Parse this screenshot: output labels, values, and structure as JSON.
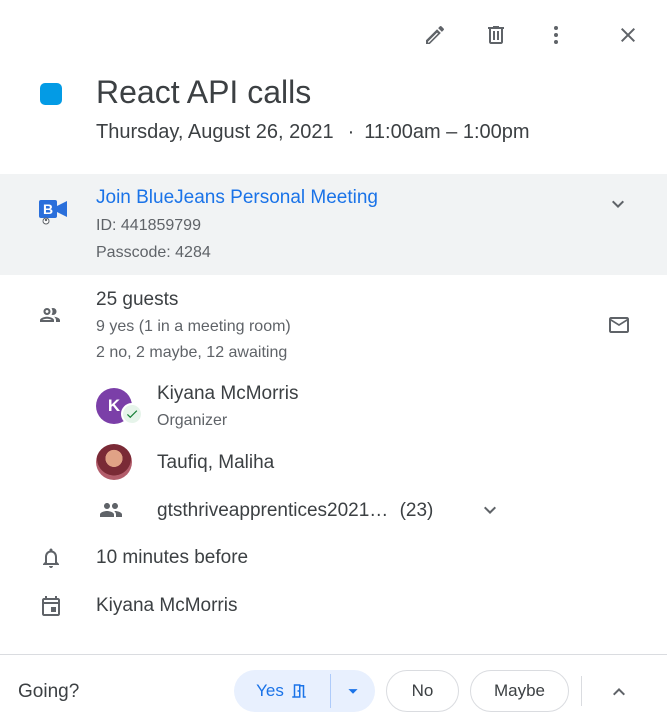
{
  "toolbar": {
    "edit_icon": "pencil-icon",
    "delete_icon": "trash-icon",
    "more_icon": "more-vert-icon",
    "close_icon": "close-icon"
  },
  "event": {
    "color": "#039be5",
    "title": "React API calls",
    "date": "Thursday, August 26, 2021",
    "separator": "·",
    "time": "11:00am – 1:00pm"
  },
  "conference": {
    "logo_icon": "bluejeans-icon",
    "join_label": "Join BlueJeans Personal Meeting",
    "id": "ID: 441859799",
    "passcode": "Passcode: 4284"
  },
  "guests": {
    "count_label": "25 guests",
    "summary_yes": "9 yes (1 in a meeting room)",
    "summary_other": "2 no, 2 maybe, 12 awaiting",
    "list": [
      {
        "initial": "K",
        "name": "Kiyana McMorris",
        "role": "Organizer"
      },
      {
        "initial": "",
        "name": "Taufiq, Maliha",
        "role": ""
      }
    ],
    "group": {
      "name": "gtsthriveapprentices2021…",
      "count": "(23)"
    }
  },
  "reminder": "10 minutes before",
  "calendar_owner": "Kiyana McMorris",
  "footer": {
    "going_label": "Going?",
    "yes_label": "Yes",
    "no_label": "No",
    "maybe_label": "Maybe"
  },
  "colors": {
    "accent": "#1a73e8",
    "yes_bg": "#e8f0fe",
    "section_bg": "#f1f3f4",
    "avatar_k": "#7b3fa8"
  }
}
